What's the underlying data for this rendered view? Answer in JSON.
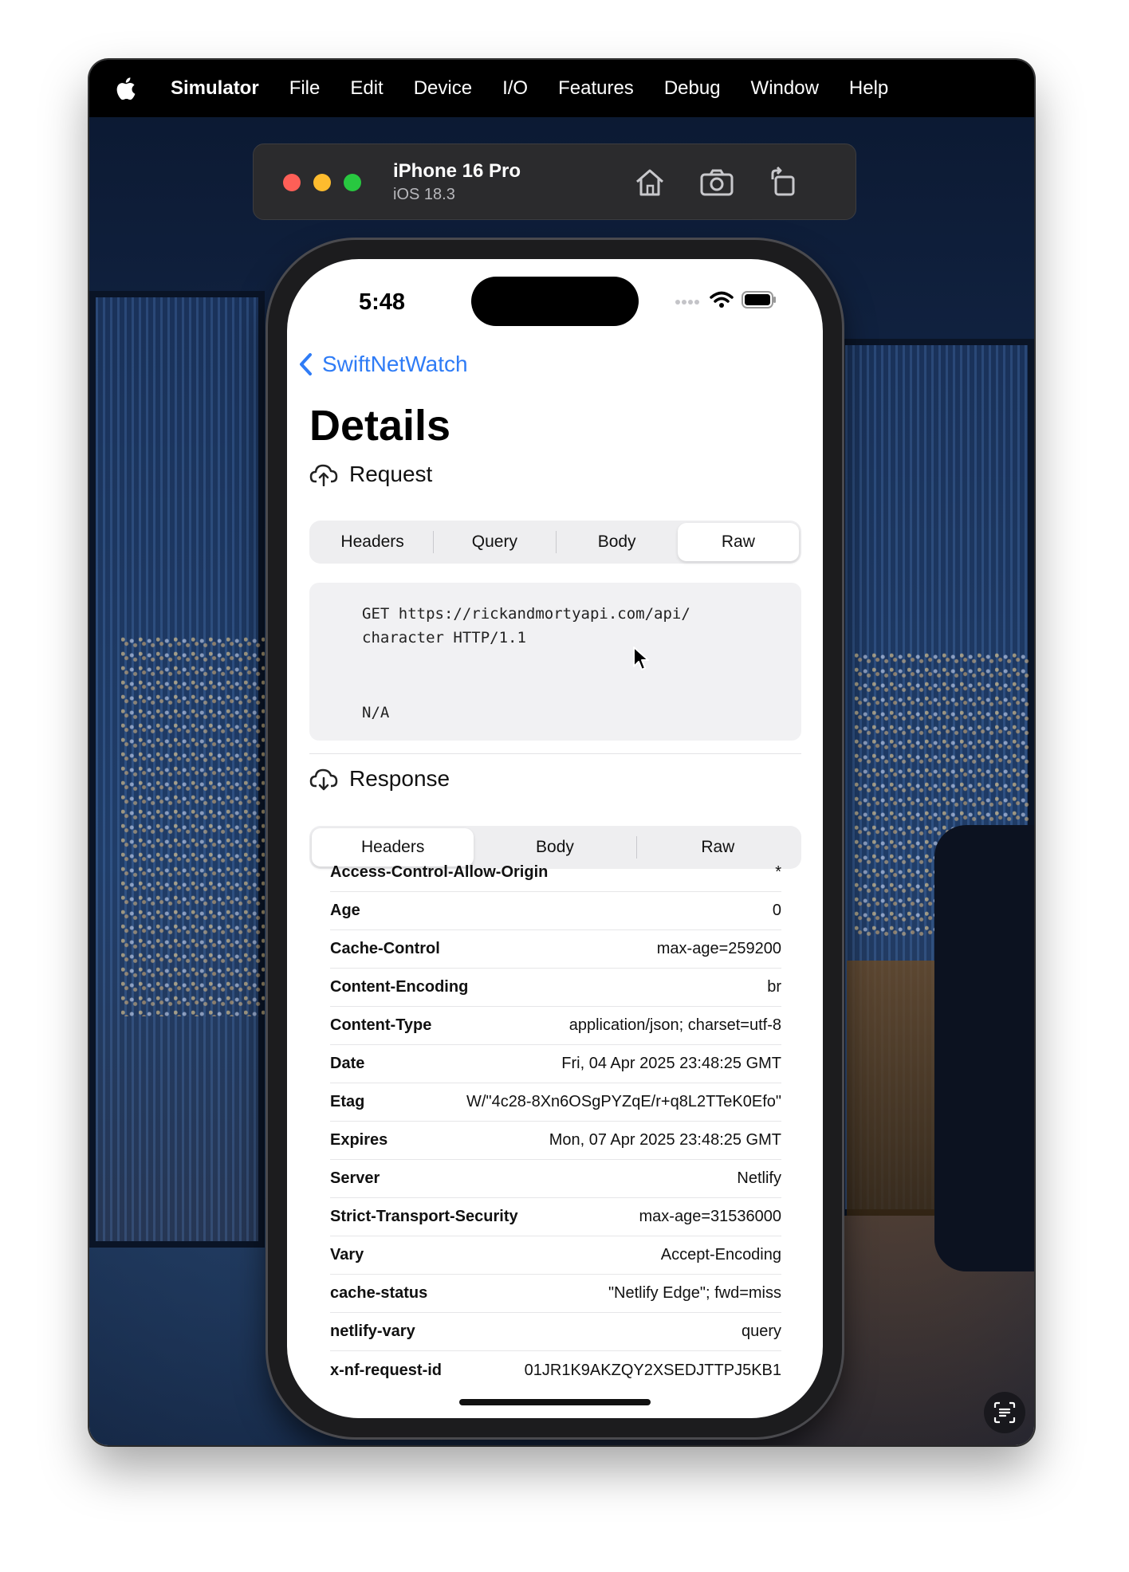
{
  "menubar": {
    "app": "Simulator",
    "items": [
      "File",
      "Edit",
      "Device",
      "I/O",
      "Features",
      "Debug",
      "Window",
      "Help"
    ]
  },
  "simulator": {
    "device_name": "iPhone 16 Pro",
    "os": "iOS 18.3",
    "tools": [
      "home-icon",
      "screenshot-icon",
      "rotate-icon"
    ]
  },
  "status": {
    "time": "5:48"
  },
  "nav": {
    "back_label": "SwiftNetWatch",
    "title": "Details"
  },
  "request": {
    "heading": "Request",
    "tabs": [
      "Headers",
      "Query",
      "Body",
      "Raw"
    ],
    "selected_tab": "Raw",
    "raw_lines": [
      "GET https://rickandmortyapi.com/api/",
      "character HTTP/1.1"
    ],
    "raw_body": "N/A"
  },
  "response": {
    "heading": "Response",
    "tabs": [
      "Headers",
      "Body",
      "Raw"
    ],
    "selected_tab": "Headers",
    "headers": [
      {
        "key": "Access-Control-Allow-Origin",
        "value": "*"
      },
      {
        "key": "Age",
        "value": "0"
      },
      {
        "key": "Cache-Control",
        "value": "max-age=259200"
      },
      {
        "key": "Content-Encoding",
        "value": "br"
      },
      {
        "key": "Content-Type",
        "value": "application/json; charset=utf-8"
      },
      {
        "key": "Date",
        "value": "Fri, 04 Apr 2025 23:48:25 GMT"
      },
      {
        "key": "Etag",
        "value": "W/\"4c28-8Xn6OSgPYZqE/r+q8L2TTeK0Efo\""
      },
      {
        "key": "Expires",
        "value": "Mon, 07 Apr 2025 23:48:25 GMT"
      },
      {
        "key": "Server",
        "value": "Netlify"
      },
      {
        "key": "Strict-Transport-Security",
        "value": "max-age=31536000"
      },
      {
        "key": "Vary",
        "value": "Accept-Encoding"
      },
      {
        "key": "cache-status",
        "value": "\"Netlify Edge\"; fwd=miss"
      },
      {
        "key": "netlify-vary",
        "value": "query"
      },
      {
        "key": "x-nf-request-id",
        "value": "01JR1K9AKZQY2XSEDJTTPJ5KB1"
      }
    ]
  },
  "colors": {
    "accent": "#2f7cf6",
    "menubar": "#000000",
    "toolbar": "#2b2b2d"
  }
}
